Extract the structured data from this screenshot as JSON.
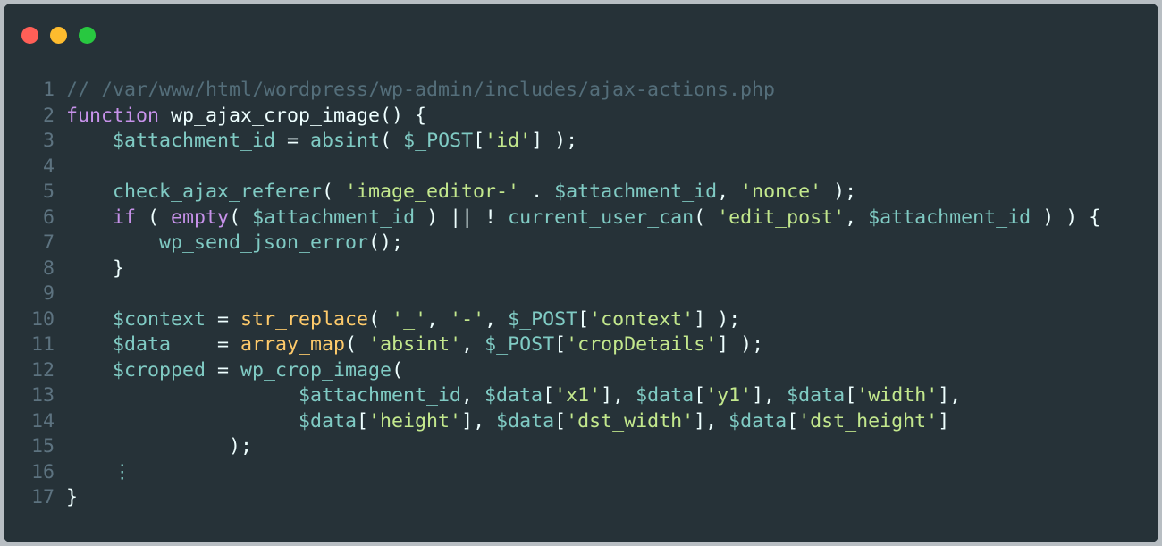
{
  "window": {
    "controls": [
      {
        "name": "close",
        "color": "#ff5f57"
      },
      {
        "name": "minimize",
        "color": "#febc2e"
      },
      {
        "name": "maximize",
        "color": "#28c840"
      }
    ]
  },
  "palette": {
    "comment": "#546e7a",
    "keyword": "#c792ea",
    "identifier": "#eeffff",
    "variable": "#80cbc4",
    "function": "#82aaff",
    "string": "#c3e88d",
    "builtin": "#ffcb6b",
    "punct": "#89ddff",
    "line_number": "#5d7380"
  },
  "code": {
    "lines": [
      {
        "n": "1",
        "tokens": [
          {
            "t": "// /var/www/html/wordpress/wp-admin/includes/ajax-actions.php",
            "k": "comment"
          }
        ]
      },
      {
        "n": "2",
        "tokens": [
          {
            "t": "function",
            "k": "keyword"
          },
          {
            "t": " wp_ajax_crop_image() {",
            "k": "identifier"
          }
        ]
      },
      {
        "n": "3",
        "tokens": [
          {
            "t": "    ",
            "k": "identifier"
          },
          {
            "t": "$attachment_id",
            "k": "variable"
          },
          {
            "t": " = ",
            "k": "identifier"
          },
          {
            "t": "absint",
            "k": "variable"
          },
          {
            "t": "( ",
            "k": "identifier"
          },
          {
            "t": "$_POST",
            "k": "variable"
          },
          {
            "t": "[",
            "k": "identifier"
          },
          {
            "t": "'id'",
            "k": "string"
          },
          {
            "t": "] );",
            "k": "identifier"
          }
        ]
      },
      {
        "n": "4",
        "tokens": []
      },
      {
        "n": "5",
        "tokens": [
          {
            "t": "    ",
            "k": "identifier"
          },
          {
            "t": "check_ajax_referer",
            "k": "variable"
          },
          {
            "t": "( ",
            "k": "identifier"
          },
          {
            "t": "'image_editor-'",
            "k": "string"
          },
          {
            "t": " . ",
            "k": "identifier"
          },
          {
            "t": "$attachment_id",
            "k": "variable"
          },
          {
            "t": ", ",
            "k": "identifier"
          },
          {
            "t": "'nonce'",
            "k": "string"
          },
          {
            "t": " );",
            "k": "identifier"
          }
        ]
      },
      {
        "n": "6",
        "tokens": [
          {
            "t": "    ",
            "k": "identifier"
          },
          {
            "t": "if",
            "k": "keyword"
          },
          {
            "t": " ( ",
            "k": "identifier"
          },
          {
            "t": "empty",
            "k": "keyword"
          },
          {
            "t": "( ",
            "k": "identifier"
          },
          {
            "t": "$attachment_id",
            "k": "variable"
          },
          {
            "t": " ) || ! ",
            "k": "identifier"
          },
          {
            "t": "current_user_can",
            "k": "variable"
          },
          {
            "t": "( ",
            "k": "identifier"
          },
          {
            "t": "'edit_post'",
            "k": "string"
          },
          {
            "t": ", ",
            "k": "identifier"
          },
          {
            "t": "$attachment_id",
            "k": "variable"
          },
          {
            "t": " ) ) {",
            "k": "identifier"
          }
        ]
      },
      {
        "n": "7",
        "tokens": [
          {
            "t": "        ",
            "k": "identifier"
          },
          {
            "t": "wp_send_json_error",
            "k": "variable"
          },
          {
            "t": "();",
            "k": "identifier"
          }
        ]
      },
      {
        "n": "8",
        "tokens": [
          {
            "t": "    }",
            "k": "identifier"
          }
        ]
      },
      {
        "n": "9",
        "tokens": []
      },
      {
        "n": "10",
        "tokens": [
          {
            "t": "    ",
            "k": "identifier"
          },
          {
            "t": "$context",
            "k": "variable"
          },
          {
            "t": " = ",
            "k": "identifier"
          },
          {
            "t": "str_replace",
            "k": "builtin"
          },
          {
            "t": "( ",
            "k": "identifier"
          },
          {
            "t": "'_'",
            "k": "string"
          },
          {
            "t": ", ",
            "k": "identifier"
          },
          {
            "t": "'-'",
            "k": "string"
          },
          {
            "t": ", ",
            "k": "identifier"
          },
          {
            "t": "$_POST",
            "k": "variable"
          },
          {
            "t": "[",
            "k": "identifier"
          },
          {
            "t": "'context'",
            "k": "string"
          },
          {
            "t": "] );",
            "k": "identifier"
          }
        ]
      },
      {
        "n": "11",
        "tokens": [
          {
            "t": "    ",
            "k": "identifier"
          },
          {
            "t": "$data",
            "k": "variable"
          },
          {
            "t": "    = ",
            "k": "identifier"
          },
          {
            "t": "array_map",
            "k": "builtin"
          },
          {
            "t": "( ",
            "k": "identifier"
          },
          {
            "t": "'absint'",
            "k": "string"
          },
          {
            "t": ", ",
            "k": "identifier"
          },
          {
            "t": "$_POST",
            "k": "variable"
          },
          {
            "t": "[",
            "k": "identifier"
          },
          {
            "t": "'cropDetails'",
            "k": "string"
          },
          {
            "t": "] );",
            "k": "identifier"
          }
        ]
      },
      {
        "n": "12",
        "tokens": [
          {
            "t": "    ",
            "k": "identifier"
          },
          {
            "t": "$cropped",
            "k": "variable"
          },
          {
            "t": " = ",
            "k": "identifier"
          },
          {
            "t": "wp_crop_image",
            "k": "variable"
          },
          {
            "t": "(",
            "k": "identifier"
          }
        ]
      },
      {
        "n": "13",
        "tokens": [
          {
            "t": "                    ",
            "k": "identifier"
          },
          {
            "t": "$attachment_id",
            "k": "variable"
          },
          {
            "t": ", ",
            "k": "identifier"
          },
          {
            "t": "$data",
            "k": "variable"
          },
          {
            "t": "[",
            "k": "identifier"
          },
          {
            "t": "'x1'",
            "k": "string"
          },
          {
            "t": "], ",
            "k": "identifier"
          },
          {
            "t": "$data",
            "k": "variable"
          },
          {
            "t": "[",
            "k": "identifier"
          },
          {
            "t": "'y1'",
            "k": "string"
          },
          {
            "t": "], ",
            "k": "identifier"
          },
          {
            "t": "$data",
            "k": "variable"
          },
          {
            "t": "[",
            "k": "identifier"
          },
          {
            "t": "'width'",
            "k": "string"
          },
          {
            "t": "],",
            "k": "identifier"
          }
        ]
      },
      {
        "n": "14",
        "tokens": [
          {
            "t": "                    ",
            "k": "identifier"
          },
          {
            "t": "$data",
            "k": "variable"
          },
          {
            "t": "[",
            "k": "identifier"
          },
          {
            "t": "'height'",
            "k": "string"
          },
          {
            "t": "], ",
            "k": "identifier"
          },
          {
            "t": "$data",
            "k": "variable"
          },
          {
            "t": "[",
            "k": "identifier"
          },
          {
            "t": "'dst_width'",
            "k": "string"
          },
          {
            "t": "], ",
            "k": "identifier"
          },
          {
            "t": "$data",
            "k": "variable"
          },
          {
            "t": "[",
            "k": "identifier"
          },
          {
            "t": "'dst_height'",
            "k": "string"
          },
          {
            "t": "]",
            "k": "identifier"
          }
        ]
      },
      {
        "n": "15",
        "tokens": [
          {
            "t": "              );",
            "k": "identifier"
          }
        ]
      },
      {
        "n": "16",
        "tokens": [
          {
            "t": "    ",
            "k": "identifier"
          },
          {
            "t": "⋮",
            "k": "variable"
          }
        ]
      },
      {
        "n": "17",
        "tokens": [
          {
            "t": "}",
            "k": "identifier"
          }
        ]
      }
    ]
  }
}
